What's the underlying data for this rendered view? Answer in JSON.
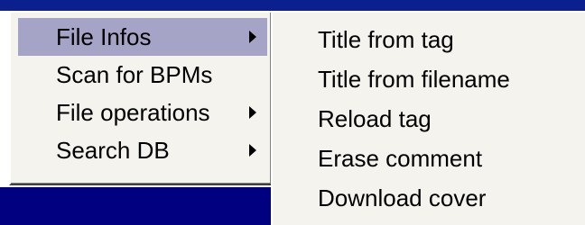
{
  "context_menu": {
    "items": [
      {
        "label": "File Infos",
        "has_submenu": true,
        "selected": true
      },
      {
        "label": "Scan for BPMs",
        "has_submenu": false,
        "selected": false
      },
      {
        "label": "File operations",
        "has_submenu": true,
        "selected": false
      },
      {
        "label": "Search DB",
        "has_submenu": true,
        "selected": false
      }
    ]
  },
  "submenu": {
    "items": [
      {
        "label": "Title from tag"
      },
      {
        "label": "Title from filename"
      },
      {
        "label": "Reload tag"
      },
      {
        "label": "Erase comment"
      },
      {
        "label": "Download cover"
      }
    ]
  },
  "colors": {
    "menu_background": "#f4f3ee",
    "highlight": "#a6a4c6",
    "window_blue": "#000080"
  },
  "icons": {
    "submenu_indicator": "triangle-right-icon"
  }
}
